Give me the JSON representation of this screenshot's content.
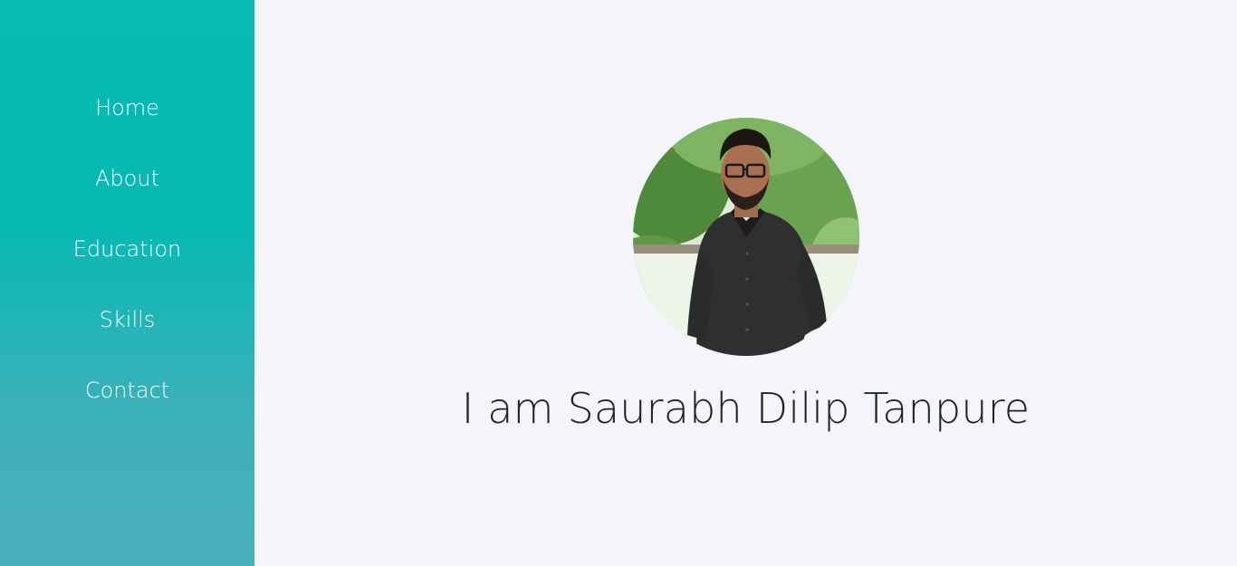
{
  "nav": {
    "items": [
      {
        "label": "Home"
      },
      {
        "label": "About"
      },
      {
        "label": "Education"
      },
      {
        "label": "Skills"
      },
      {
        "label": "Contact"
      }
    ]
  },
  "hero": {
    "avatar_icon": "profile-photo",
    "headline": "I am Saurabh Dilip Tanpure"
  },
  "colors": {
    "sidebar_top": "#05bbb4",
    "sidebar_bottom": "#4aafbc",
    "background": "#f4f5f9",
    "text": "#1f2327"
  }
}
